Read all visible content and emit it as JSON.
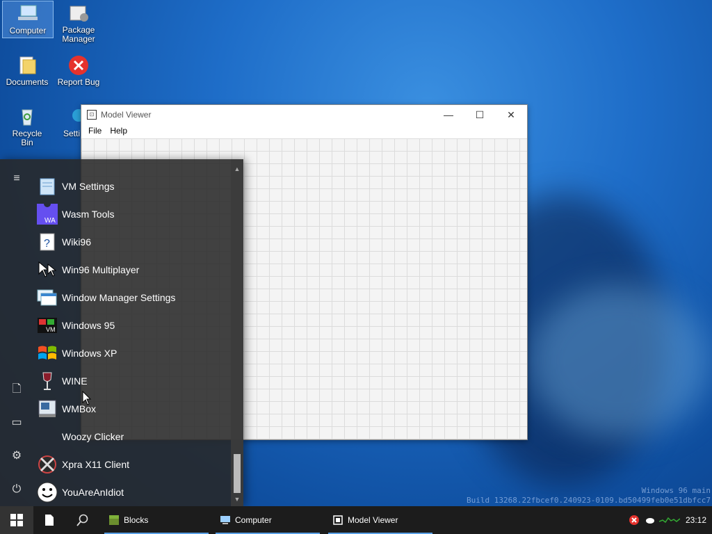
{
  "desktop": {
    "icons": [
      {
        "label": "Computer"
      },
      {
        "label": "Package Manager"
      },
      {
        "label": "Documents"
      },
      {
        "label": "Report Bug"
      },
      {
        "label": "Recycle Bin"
      },
      {
        "label": "Setti"
      }
    ]
  },
  "window": {
    "title": "Model Viewer",
    "menu": [
      "File",
      "Help"
    ],
    "controls": {
      "minimize": "—",
      "maximize": "☐",
      "close": "✕"
    }
  },
  "start_menu": {
    "apps": [
      {
        "label": "VM Settings",
        "icon": "notepad-icon"
      },
      {
        "label": "Wasm Tools",
        "icon": "wasm-icon"
      },
      {
        "label": "Wiki96",
        "icon": "help-icon"
      },
      {
        "label": "Win96 Multiplayer",
        "icon": "cursors-icon"
      },
      {
        "label": "Window Manager Settings",
        "icon": "windows-stack-icon"
      },
      {
        "label": "Windows 95",
        "icon": "vm-icon"
      },
      {
        "label": "Windows XP",
        "icon": "xp-flag-icon"
      },
      {
        "label": "WINE",
        "icon": "wine-glass-icon"
      },
      {
        "label": "WMBox",
        "icon": "wmbox-icon"
      },
      {
        "label": "Woozy Clicker",
        "icon": ""
      },
      {
        "label": "Xpra X11 Client",
        "icon": "xpra-icon"
      },
      {
        "label": "YouAreAnIdiot",
        "icon": "smiley-icon"
      }
    ]
  },
  "taskbar": {
    "tasks": [
      {
        "label": "Blocks"
      },
      {
        "label": "Computer"
      },
      {
        "label": "Model Viewer"
      }
    ],
    "clock": "23:12"
  },
  "watermark": {
    "line1": "Windows 96 main",
    "line2": "Build 13268.22fbcef0.240923-0109.bd50499feb0e51dbfcc7"
  },
  "colors": {
    "accent": "#5aa0e6",
    "start_bg": "#282828",
    "taskbar_bg": "#1c1c1c"
  }
}
